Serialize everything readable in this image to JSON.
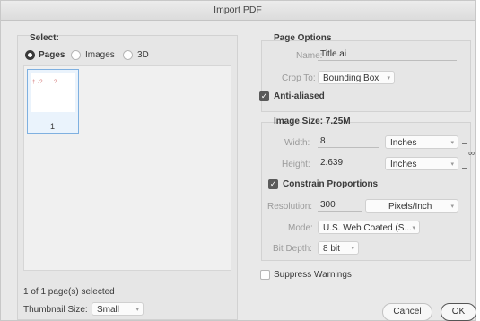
{
  "window": {
    "title": "Import PDF"
  },
  "select_panel": {
    "heading": "Select:",
    "radios": [
      {
        "label": "Pages",
        "selected": true
      },
      {
        "label": "Images",
        "selected": false
      },
      {
        "label": "3D",
        "selected": false
      }
    ],
    "thumbnail": {
      "page_number": "1",
      "preview_text": "† .?– – ?– —"
    },
    "status": "1 of 1 page(s) selected",
    "thumbnail_size_label": "Thumbnail Size:",
    "thumbnail_size_value": "Small"
  },
  "page_options": {
    "heading": "Page Options",
    "name_label": "Name:",
    "name_value": "Title.ai",
    "crop_label": "Crop To:",
    "crop_value": "Bounding Box",
    "anti_aliased_label": "Anti-aliased",
    "anti_aliased_checked": true
  },
  "image_size": {
    "heading": "Image Size: 7.25M",
    "width_label": "Width:",
    "width_value": "8",
    "width_unit": "Inches",
    "height_label": "Height:",
    "height_value": "2.639",
    "height_unit": "Inches",
    "constrain_label": "Constrain Proportions",
    "constrain_checked": true,
    "resolution_label": "Resolution:",
    "resolution_value": "300",
    "resolution_unit": "Pixels/Inch",
    "mode_label": "Mode:",
    "mode_value": "U.S. Web Coated (S...",
    "bitdepth_label": "Bit Depth:",
    "bitdepth_value": "8 bit"
  },
  "suppress_warnings": {
    "label": "Suppress Warnings",
    "checked": false
  },
  "buttons": {
    "cancel": "Cancel",
    "ok": "OK"
  },
  "icons": {
    "chain_link": "chain-link-icon",
    "dropdown_arrow": "chevron-down-icon"
  }
}
